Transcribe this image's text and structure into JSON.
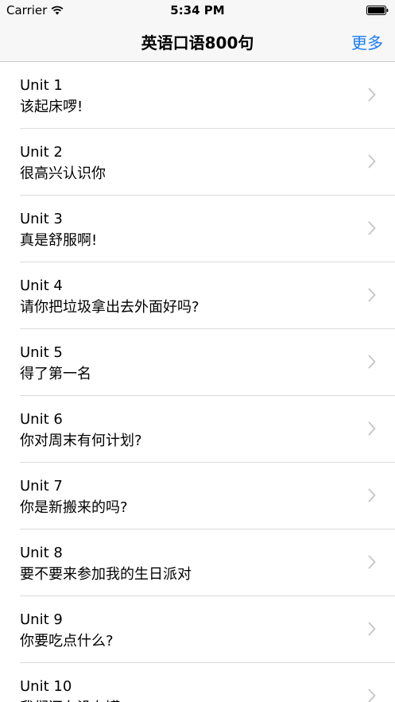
{
  "status_bar": {
    "carrier": "Carrier",
    "time": "5:34 PM"
  },
  "nav": {
    "title": "英语口语800句",
    "more_label": "更多"
  },
  "colors": {
    "accent": "#1a7cf6",
    "bar_background": "#f7f7f7",
    "separator": "#dcdcdf",
    "chevron": "#c7c7cc"
  },
  "units": [
    {
      "unit": "Unit 1",
      "title": "该起床啰!"
    },
    {
      "unit": "Unit 2",
      "title": "很高兴认识你"
    },
    {
      "unit": "Unit 3",
      "title": "真是舒服啊!"
    },
    {
      "unit": "Unit 4",
      "title": "请你把垃圾拿出去外面好吗?"
    },
    {
      "unit": "Unit 5",
      "title": "得了第一名"
    },
    {
      "unit": "Unit 6",
      "title": "你对周末有何计划?"
    },
    {
      "unit": "Unit 7",
      "title": "你是新搬来的吗?"
    },
    {
      "unit": "Unit 8",
      "title": "要不要来参加我的生日派对"
    },
    {
      "unit": "Unit 9",
      "title": "你要吃点什么?"
    },
    {
      "unit": "Unit 10",
      "title": "我们还有没有罐..."
    }
  ]
}
